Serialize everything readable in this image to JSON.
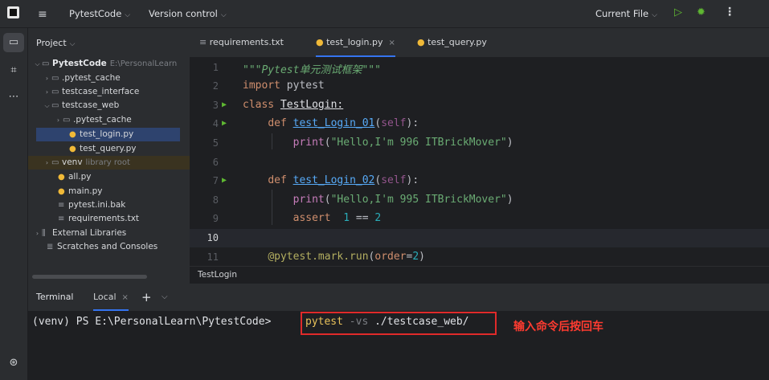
{
  "titlebar": {
    "project_name": "PytestCode",
    "vcs_label": "Version control",
    "run_config": "Current File"
  },
  "project_panel": {
    "title": "Project",
    "rows": [
      {
        "label": "PytestCode",
        "hint": "E:\\PersonalLearn"
      },
      {
        "label": ".pytest_cache"
      },
      {
        "label": "testcase_interface"
      },
      {
        "label": "testcase_web"
      },
      {
        "label": ".pytest_cache"
      },
      {
        "label": "test_login.py"
      },
      {
        "label": "test_query.py"
      },
      {
        "label": "venv",
        "hint": "library root"
      },
      {
        "label": "all.py"
      },
      {
        "label": "main.py"
      },
      {
        "label": "pytest.ini.bak"
      },
      {
        "label": "requirements.txt"
      },
      {
        "label": "External Libraries"
      },
      {
        "label": "Scratches and Consoles"
      }
    ]
  },
  "editor": {
    "tabs": [
      {
        "label": "requirements.txt"
      },
      {
        "label": "test_login.py"
      },
      {
        "label": "test_query.py"
      }
    ],
    "line_numbers": [
      "1",
      "2",
      "3",
      "4",
      "5",
      "6",
      "7",
      "8",
      "9",
      "10",
      "11"
    ],
    "code": {
      "l1": "\"\"\"Pytest单元测试框架\"\"\"",
      "l2_kw": "import",
      "l2_rest": " pytest",
      "l3_kw": "class",
      "l3_name": "TestLogin:",
      "l4_kw": "def",
      "l4_fn": "test_Login_01",
      "l4_open": "(",
      "l4_self": "self",
      "l4_close": "):",
      "l5_fn": "print",
      "l5_str": "\"Hello,I'm 996 ITBrickMover\"",
      "l7_kw": "def",
      "l7_fn": "test_Login_02",
      "l7_open": "(",
      "l7_self": "self",
      "l7_close": "):",
      "l8_fn": "print",
      "l8_str": "\"Hello,I'm 995 ITBrickMover\"",
      "l9_kw": "assert",
      "l9_num1": "1",
      "l9_op": " == ",
      "l9_num2": "2",
      "l11_dec": "@pytest.mark.run",
      "l11_param": "order",
      "l11_eq": "=",
      "l11_val": "2"
    },
    "breadcrumb": "TestLogin"
  },
  "terminal": {
    "title": "Terminal",
    "tab": "Local",
    "prompt": "(venv) PS E:\\PersonalLearn\\PytestCode>",
    "cmd_program": "pytest",
    "cmd_option": "-vs",
    "cmd_path": "./testcase_web/",
    "annotation": "输入命令后按回车"
  },
  "colors": {
    "accent": "#3574f0",
    "run_green": "#5fb832",
    "annotation_red": "#e02a2a"
  }
}
